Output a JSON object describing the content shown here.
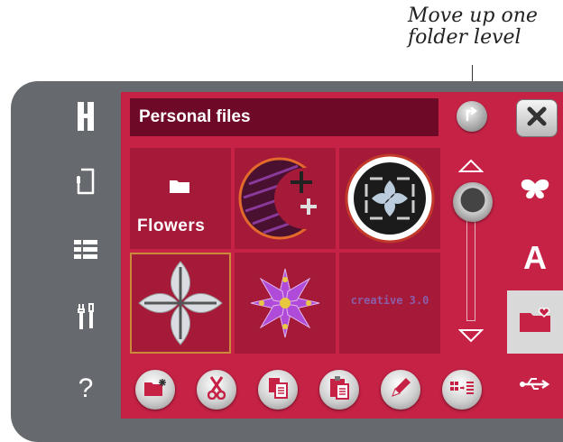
{
  "callout": {
    "line1": "Move up one",
    "line2": "folder level"
  },
  "header": {
    "title": "Personal files"
  },
  "grid": {
    "items": [
      {
        "type": "folder",
        "label": "Flowers"
      },
      {
        "type": "design",
        "name": "moon-design"
      },
      {
        "type": "design",
        "name": "circle-frame-design"
      },
      {
        "type": "design",
        "name": "four-petal-design",
        "selected": true
      },
      {
        "type": "design",
        "name": "flower-design"
      },
      {
        "type": "design",
        "name": "text-design",
        "text": "creative 3.0"
      }
    ]
  },
  "left_bar": {
    "items": [
      "h-logo-icon",
      "device-icon",
      "menu-list-icon",
      "tools-icon",
      "help-icon"
    ],
    "help_text": "?"
  },
  "right_tabs": {
    "items": [
      "butterfly-icon",
      "letter-a-icon",
      "folder-heart-icon",
      "usb-icon"
    ],
    "letter": "A",
    "active": "folder-heart-icon"
  },
  "bottom_tools": [
    "new-folder-icon",
    "cut-icon",
    "copy-icon",
    "paste-icon",
    "rename-icon",
    "view-toggle-icon"
  ],
  "colors": {
    "screen_bg": "#c62246",
    "title_bg": "#6e0a28",
    "cell_bg": "#a51939",
    "device_bg": "#666a6e",
    "active_tab_bg": "#d9d9d9"
  }
}
